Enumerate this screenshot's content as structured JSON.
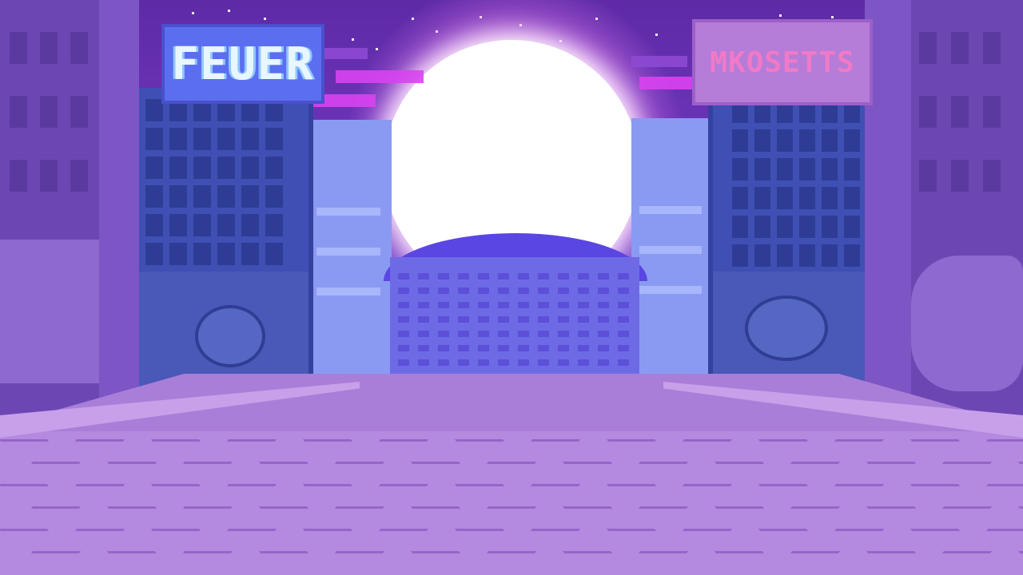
{
  "scene": {
    "signs": {
      "left_sign_text": "FEUER",
      "right_sign_text": "MKOSETTS"
    },
    "colors": {
      "sky": "#6a33b6",
      "sun": "#ffffff",
      "sun_glow": "#f484fa",
      "far_city": "#6e6ae6",
      "mid_buildings": "#3f4fb3",
      "street": "#b48ae0",
      "feuer_sign": "#5c6ef0",
      "right_sign": "#b57cd8"
    },
    "icons": {
      "left_doodle": "cloud-face-doodle",
      "right_doodle": "cloud-doodle"
    }
  }
}
